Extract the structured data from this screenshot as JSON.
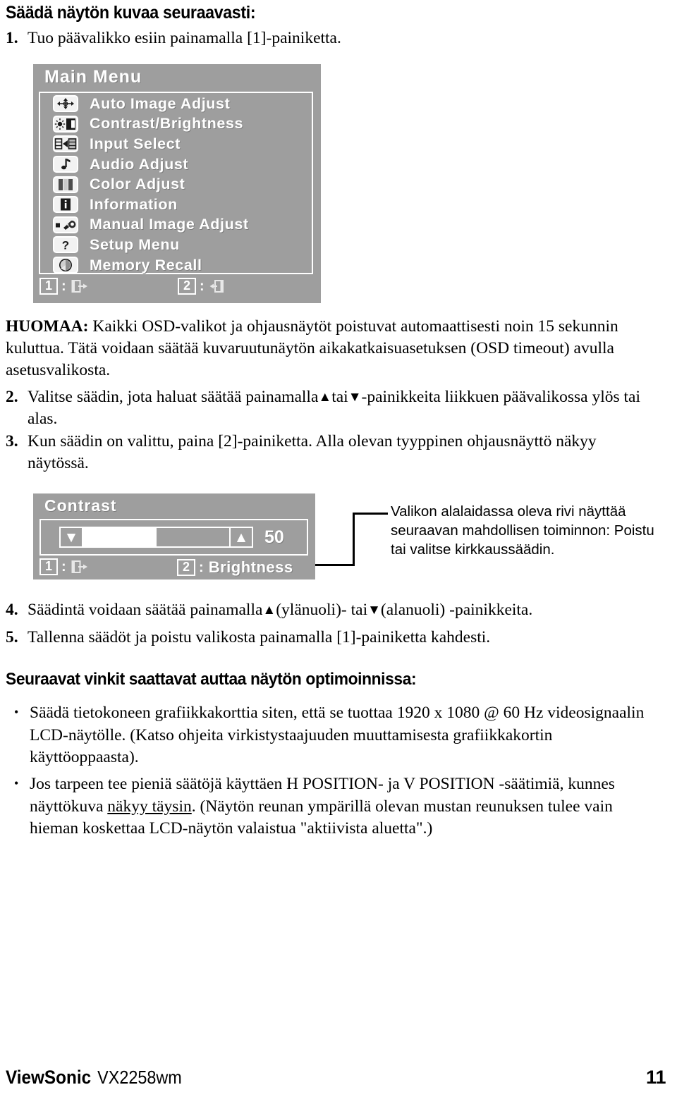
{
  "heading": "Säädä näytön kuvaa seuraavasti:",
  "steps": [
    {
      "num": "1.",
      "text": "Tuo päävalikko esiin painamalla [1]-painiketta."
    },
    {
      "num": "2.",
      "pre": "Valitse säädin, jota haluat säätää painamalla",
      "mid": "tai",
      "post": "-painikkeita liikkuen päävalikossa ylös tai alas."
    },
    {
      "num": "3.",
      "text": "Kun säädin on valittu, paina [2]-painiketta. Alla olevan tyyppinen ohjausnäyttö näkyy näytössä."
    },
    {
      "num": "4.",
      "pre": "Säädintä voidaan säätää painamalla",
      "mid": "(ylänuoli)- tai",
      "post": "(alanuoli) -painikkeita."
    },
    {
      "num": "5.",
      "text": "Tallenna säädöt ja poistu valikosta painamalla [1]-painiketta kahdesti."
    }
  ],
  "note": {
    "label": "HUOMAA:",
    "text": " Kaikki OSD-valikot ja ohjausnäytöt poistuvat automaattisesti noin 15 sekunnin kuluttua. Tätä voidaan säätää kuvaruutunäytön aikakatkaisuasetuksen (OSD timeout) avulla asetusvalikosta."
  },
  "main_menu": {
    "title": "Main Menu",
    "items": [
      {
        "icon": "auto-image-adjust-icon",
        "label": "Auto Image Adjust"
      },
      {
        "icon": "contrast-brightness-icon",
        "label": "Contrast/Brightness"
      },
      {
        "icon": "input-select-icon",
        "label": "Input Select"
      },
      {
        "icon": "audio-adjust-icon",
        "label": "Audio Adjust"
      },
      {
        "icon": "color-adjust-icon",
        "label": "Color Adjust"
      },
      {
        "icon": "information-icon",
        "label": "Information"
      },
      {
        "icon": "manual-image-adjust-icon",
        "label": "Manual Image Adjust"
      },
      {
        "icon": "setup-menu-icon",
        "label": "Setup Menu"
      },
      {
        "icon": "memory-recall-icon",
        "label": "Memory Recall"
      }
    ],
    "footer": {
      "key1": "1",
      "colon1": ":",
      "action1_icon": "exit-arrow-icon",
      "key2": "2",
      "colon2": ":",
      "action2_icon": "enter-arrow-icon"
    }
  },
  "contrast_panel": {
    "title": "Contrast",
    "decrease_icon": "down-triangle-icon",
    "increase_icon": "up-triangle-icon",
    "value": "50",
    "fill_percent": 50,
    "footer": {
      "key1": "1",
      "colon1": ":",
      "action1_icon": "exit-arrow-icon",
      "key2": "2",
      "colon2": ":",
      "action2_label": "Brightness"
    }
  },
  "callout": {
    "text": "Valikon alalaidassa oleva rivi näyttää seuraavan mahdollisen toiminnon: Poistu tai valitse kirkkaussäädin."
  },
  "tips": {
    "heading": "Seuraavat vinkit saattavat auttaa näytön optimoinnissa:",
    "bullets": [
      {
        "text": "Säädä tietokoneen grafiikkakorttia siten, että se tuottaa 1920 x 1080 @ 60 Hz videosignaalin LCD-näytölle. (Katso ohjeita virkistystaajuuden muuttamisesta grafiikkakortin käyttöoppaasta)."
      },
      {
        "pre": "Jos tarpeen tee pieniä säätöjä käyttäen H POSITION- ja V POSITION -säätimiä, kunnes näyttökuva ",
        "underline": "näkyy täysin",
        "post": ". (Näytön reunan ympärillä olevan mustan reunuksen tulee vain hieman koskettaa LCD-näytön valaistua \"aktiivista aluetta\".)"
      }
    ]
  },
  "page_footer": {
    "brand": "ViewSonic",
    "model": "VX2258wm",
    "page_number": "11"
  },
  "colors": {
    "osd_bg": "#9e9e9e",
    "osd_text": "#ffffff",
    "icon_bg": "#f2f2f2",
    "page_bg": "#ffffff",
    "ink": "#000000"
  }
}
